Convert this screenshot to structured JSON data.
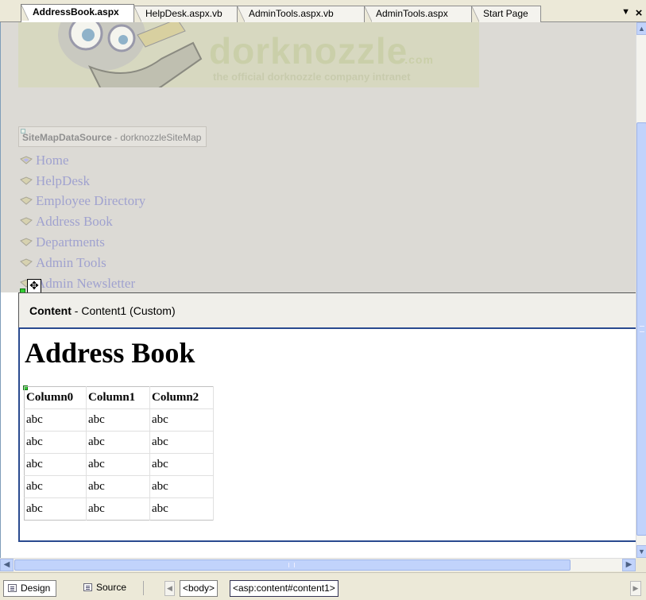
{
  "tabs": [
    {
      "label": "AddressBook.aspx",
      "active": true
    },
    {
      "label": "HelpDesk.aspx.vb",
      "active": false
    },
    {
      "label": "AdminTools.aspx.vb",
      "active": false
    },
    {
      "label": "AdminTools.aspx",
      "active": false
    },
    {
      "label": "Start Page",
      "active": false
    }
  ],
  "tab_controls": {
    "dropdown_icon": "chevron-down-icon",
    "close_icon": "close-icon",
    "close_glyph": "×",
    "dropdown_glyph": "▼"
  },
  "banner": {
    "logo": "dorknozzle",
    "logo_suffix": ".com",
    "tagline": "the official dorknozzle company intranet"
  },
  "sitemap_datasource": {
    "name": "SiteMapDataSource",
    "separator": " - ",
    "id": "dorknozzleSiteMap"
  },
  "menu": {
    "items": [
      "Home",
      "HelpDesk",
      "Employee Directory",
      "Address Book",
      "Departments",
      "Admin Tools",
      "Admin Newsletter"
    ]
  },
  "content_region": {
    "type": "Content",
    "separator": " - ",
    "id": "Content1 (Custom)"
  },
  "page": {
    "title": "Address Book",
    "grid": {
      "columns": [
        "Column0",
        "Column1",
        "Column2"
      ],
      "rows": [
        [
          "abc",
          "abc",
          "abc"
        ],
        [
          "abc",
          "abc",
          "abc"
        ],
        [
          "abc",
          "abc",
          "abc"
        ],
        [
          "abc",
          "abc",
          "abc"
        ],
        [
          "abc",
          "abc",
          "abc"
        ]
      ]
    }
  },
  "bottom_bar": {
    "views": [
      {
        "label": "Design",
        "active": true
      },
      {
        "label": "Source",
        "active": false
      }
    ],
    "tag_path": [
      "<body>",
      "<asp:content#content1>"
    ]
  },
  "colors": {
    "selection_border": "#2a4a8f",
    "menu_text": "#a0a2cf",
    "scrollbar": "#c1d3fb"
  }
}
